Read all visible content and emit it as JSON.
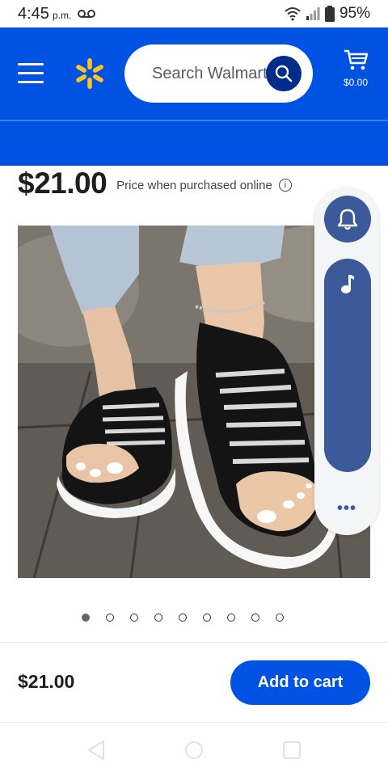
{
  "status_bar": {
    "time": "4:45",
    "ampm": "p.m.",
    "battery": "95%"
  },
  "header": {
    "search_placeholder": "Search Walmart",
    "cart_amount": "$0.00",
    "brand_color": "#0053e2",
    "spark_color": "#ffc220"
  },
  "product": {
    "price": "$21.00",
    "price_note": "Price when purchased online",
    "image_icon": "sandals-photo"
  },
  "side_panel": {
    "bell_icon": "bell-icon",
    "music_icon": "music-note-icon",
    "more": "•••"
  },
  "carousel": {
    "count": 9,
    "active_index": 0
  },
  "bottom_bar": {
    "price": "$21.00",
    "add_to_cart": "Add to cart"
  }
}
